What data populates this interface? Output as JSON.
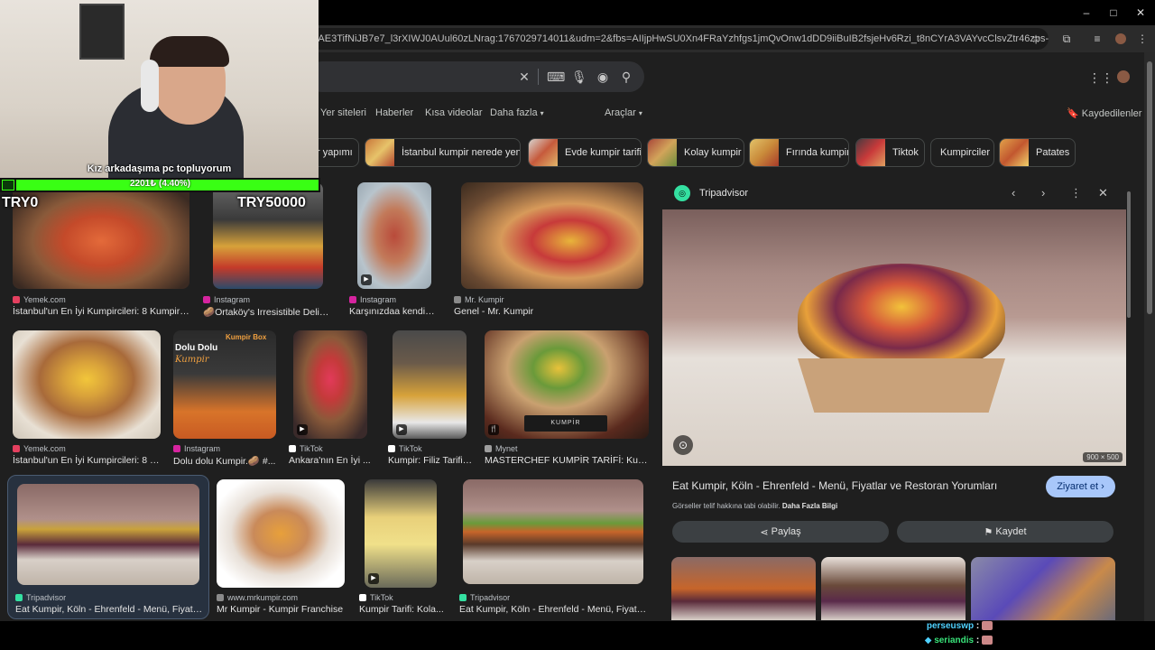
{
  "browser": {
    "url": "=AE3TifNiJB7e7_l3rXIWJ0AUul60zLNrag:1767029714011&udm=2&fbs=AIIjpHwSU0Xn4FRaYzhfgs1jmQvOnw1dDD9iiBuIB2fsjeHv6Rzi_t8nCYrA3VAYvcClsvZtr46zps-73XVWEL76eMkvoInFtHb...",
    "window_controls": [
      "–",
      "□",
      "✕"
    ]
  },
  "google": {
    "nav_tabs": [
      "Yer siteleri",
      "Haberler",
      "Kısa videolar",
      "Daha fazla"
    ],
    "tools_label": "Araçlar",
    "saved_label": "Kaydedilenler",
    "chips": [
      "r yapımı",
      "İstanbul kumpir nerede yenir",
      "Evde kumpir tarifi",
      "Kolay kumpir",
      "Fırında kumpir",
      "Tiktok",
      "Kumpirciler",
      "Patates"
    ]
  },
  "results": [
    {
      "source": "Yemek.com",
      "caption": "İstanbul'un En İyi Kumpircileri: 8 Kumpir ...",
      "src_color": "#e4405f"
    },
    {
      "source": "Instagram",
      "caption": "🥔Ortaköy's Irresistible Delight...",
      "src_color": "#d6249f"
    },
    {
      "source": "Instagram",
      "caption": "Karşınızdaa kendini ...",
      "src_color": "#d6249f"
    },
    {
      "source": "Mr. Kumpir",
      "caption": "Genel - Mr. Kumpir",
      "src_color": "#8a8a8a"
    },
    {
      "source": "Yemek.com",
      "caption": "İstanbul'un En İyi Kumpircileri: 8 K...",
      "src_color": "#e4405f"
    },
    {
      "source": "Instagram",
      "caption": "Dolu dolu Kumpir.🥔 #...",
      "src_color": "#d6249f"
    },
    {
      "source": "TikTok",
      "caption": "Ankara'nın En İyi ...",
      "src_color": "#ffffff"
    },
    {
      "source": "TikTok",
      "caption": "Kumpir: Filiz Tarifi i...",
      "src_color": "#ffffff"
    },
    {
      "source": "Mynet",
      "caption": "MASTERCHEF KUMPİR TARİFİ: Kum...",
      "src_color": "#9e9e9e"
    },
    {
      "source": "Tripadvisor",
      "caption": "Eat Kumpir, Köln - Ehrenfeld - Menü, Fiyatlar ...",
      "src_color": "#34e0a1"
    },
    {
      "source": "www.mrkumpir.com",
      "caption": "Mr Kumpir - Kumpir Franchise",
      "src_color": "#8a8a8a"
    },
    {
      "source": "TikTok",
      "caption": "Kumpir Tarifi: Kola...",
      "src_color": "#ffffff"
    },
    {
      "source": "Tripadvisor",
      "caption": "Eat Kumpir, Köln - Ehrenfeld - Menü, Fiyatlar ...",
      "src_color": "#34e0a1"
    }
  ],
  "image_text": {
    "dolu_dolu": "Dolu Dolu",
    "kumpir_script": "Kumpir",
    "kumpir_box": "Kumpir Box",
    "masterchef_box": "KUMPİR"
  },
  "preview": {
    "source": "Tripadvisor",
    "size": "900 × 500",
    "title": "Eat Kumpir, Köln - Ehrenfeld - Menü, Fiyatlar ve Restoran Yorumları",
    "notice": "Görseller telif hakkına tabi olabilir.",
    "more_info": "Daha Fazla Bilgi",
    "visit": "Ziyaret et",
    "share": "Paylaş",
    "save": "Kaydet"
  },
  "stream": {
    "goal_title": "Kız arkadaşıma pc topluyorum",
    "goal_progress": "2201₺ (4.40%)",
    "goal_progress_fraction": 0.044,
    "goal_min": "TRY0",
    "goal_max": "TRY50000",
    "chat": [
      {
        "user": "perseuswp",
        "color": "#4fd1ff"
      },
      {
        "user": "seriandis",
        "color": "#39e37a"
      }
    ]
  }
}
